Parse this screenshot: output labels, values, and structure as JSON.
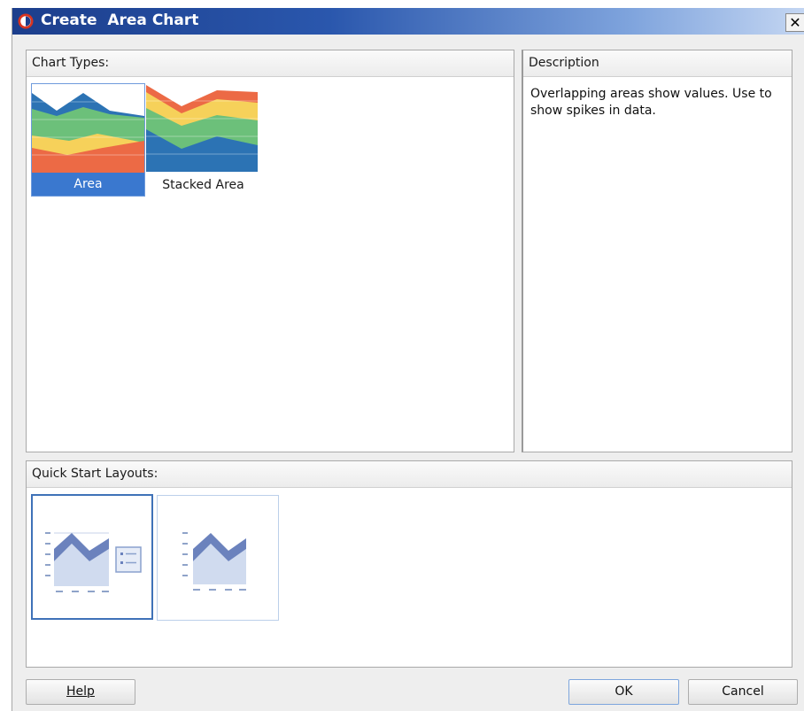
{
  "dialog": {
    "title": "Create  Area Chart",
    "close_label": "✕"
  },
  "chart_types": {
    "header": "Chart Types:",
    "items": [
      {
        "label": "Area",
        "selected": true
      },
      {
        "label": "Stacked Area",
        "selected": false
      }
    ]
  },
  "description": {
    "header": "Description",
    "text": "Overlapping areas show values. Use to show spikes in data."
  },
  "quick_start": {
    "header": "Quick Start Layouts:",
    "layouts": [
      {
        "name": "chart with legend",
        "selected": true
      },
      {
        "name": "chart only",
        "selected": false
      }
    ]
  },
  "buttons": {
    "help": "Help",
    "ok": "OK",
    "cancel": "Cancel"
  },
  "colors": {
    "title_bar_start": "#1c3e8c",
    "selection": "#3a78cf",
    "chart_blue": "#2c73b4",
    "chart_green": "#6cc07a",
    "chart_yellow": "#f6d15a",
    "chart_orange": "#ec6a45"
  }
}
